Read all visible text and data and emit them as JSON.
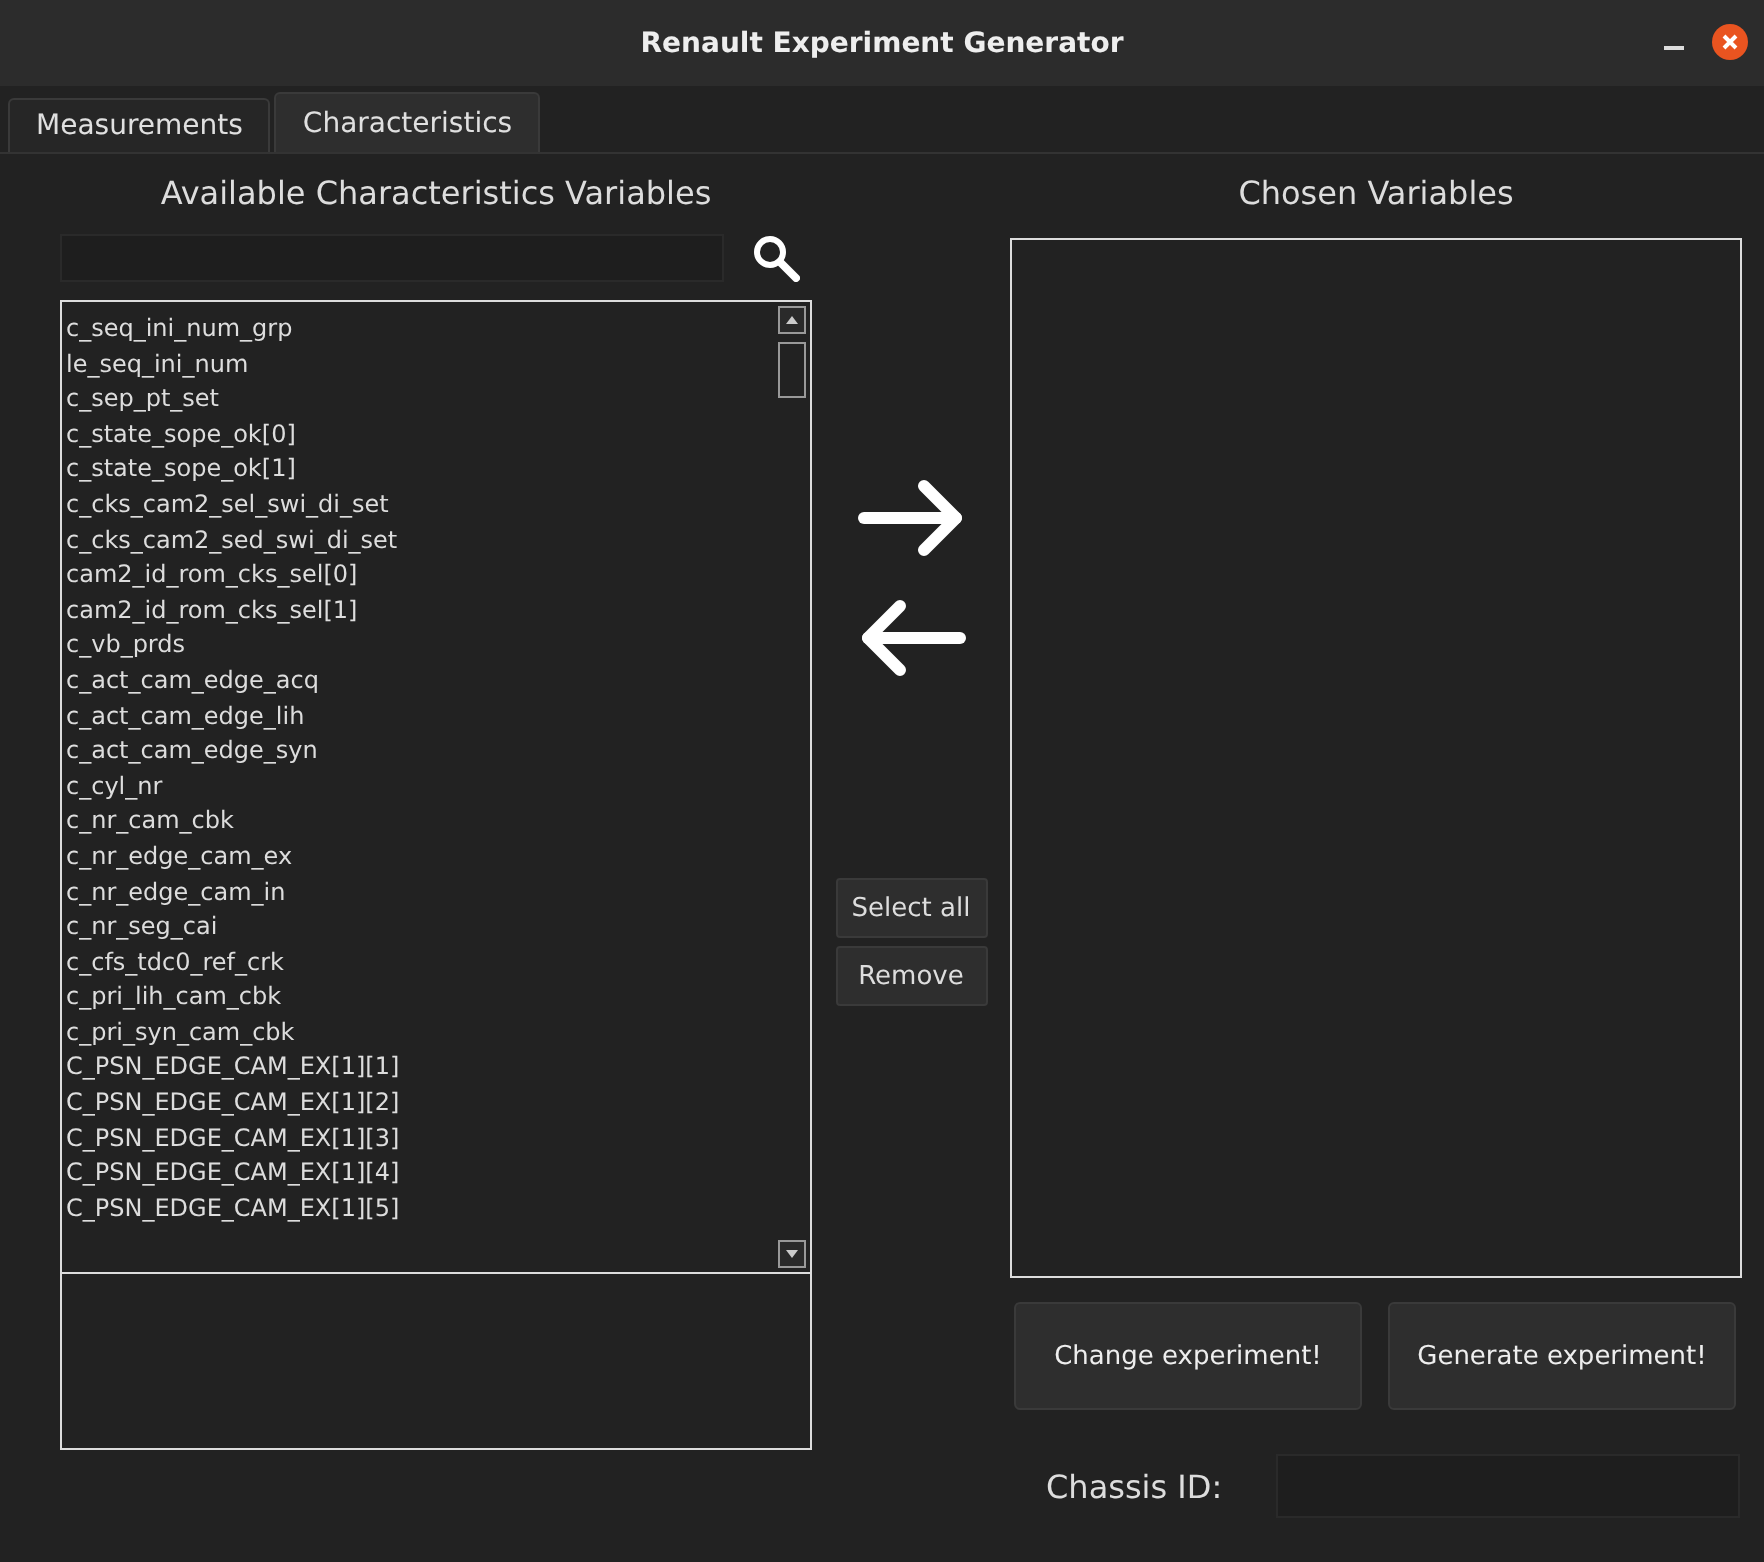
{
  "window": {
    "title": "Renault Experiment Generator"
  },
  "tabs": [
    {
      "label": "Measurements",
      "selected": false
    },
    {
      "label": "Characteristics",
      "selected": true
    }
  ],
  "available": {
    "heading": "Available Characteristics Variables",
    "items": [
      "c_seq_ini_num_grp",
      "le_seq_ini_num",
      "c_sep_pt_set",
      "c_state_sope_ok[0]",
      "c_state_sope_ok[1]",
      "c_cks_cam2_sel_swi_di_set",
      "c_cks_cam2_sed_swi_di_set",
      "cam2_id_rom_cks_sel[0]",
      "cam2_id_rom_cks_sel[1]",
      "c_vb_prds",
      "c_act_cam_edge_acq",
      "c_act_cam_edge_lih",
      "c_act_cam_edge_syn",
      "c_cyl_nr",
      "c_nr_cam_cbk",
      "c_nr_edge_cam_ex",
      "c_nr_edge_cam_in",
      "c_nr_seg_cai",
      "c_cfs_tdc0_ref_crk",
      "c_pri_lih_cam_cbk",
      "c_pri_syn_cam_cbk",
      "C_PSN_EDGE_CAM_EX[1][1]",
      "C_PSN_EDGE_CAM_EX[1][2]",
      "C_PSN_EDGE_CAM_EX[1][3]",
      "C_PSN_EDGE_CAM_EX[1][4]",
      "C_PSN_EDGE_CAM_EX[1][5]"
    ]
  },
  "middle_buttons": [
    "Select all",
    "Remove"
  ],
  "chosen": {
    "heading": "Chosen Variables"
  },
  "actions": [
    "Change experiment!",
    "Generate experiment!"
  ],
  "chassis": {
    "label": "Chassis ID:"
  }
}
